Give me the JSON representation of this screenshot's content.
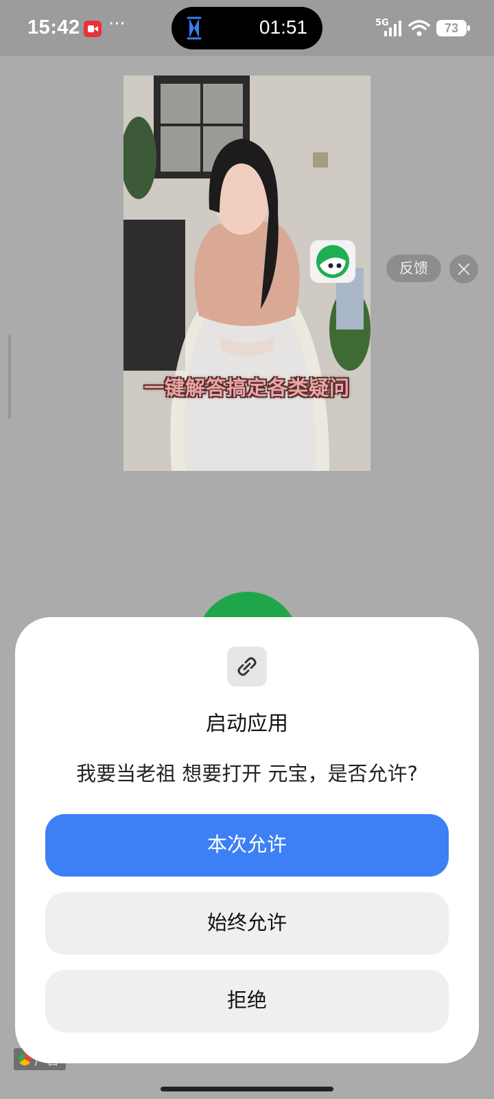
{
  "status_bar": {
    "time": "15:42",
    "more": "···",
    "timer": "01:51",
    "network": "5G",
    "battery": "73"
  },
  "ad": {
    "caption": "一键解答搞定各类疑问",
    "feedback_label": "反馈",
    "badge_label": "广告"
  },
  "dialog": {
    "title": "启动应用",
    "message": "我要当老祖 想要打开 元宝，是否允许?",
    "allow_once_label": "本次允许",
    "always_allow_label": "始终允许",
    "deny_label": "拒绝"
  },
  "colors": {
    "primary": "#3d80f5",
    "scrim": "#ababab",
    "recording": "#e8323a"
  }
}
